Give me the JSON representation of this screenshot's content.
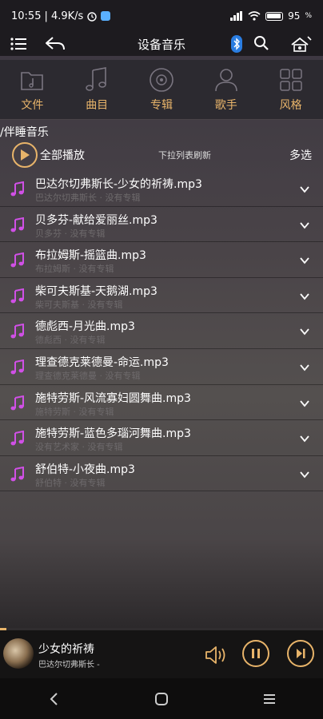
{
  "status_bar": {
    "time": "10:55",
    "speed": "| 4.9K/s",
    "battery": "95"
  },
  "header": {
    "title": "设备音乐"
  },
  "categories": [
    {
      "label": "文件",
      "icon": "folder-music-icon"
    },
    {
      "label": "曲目",
      "icon": "music-note-icon"
    },
    {
      "label": "专辑",
      "icon": "disc-icon"
    },
    {
      "label": "歌手",
      "icon": "person-icon"
    },
    {
      "label": "风格",
      "icon": "grid-icon"
    }
  ],
  "breadcrumb": "/伴睡音乐",
  "actions": {
    "play_all": "全部播放",
    "refresh_hint": "下拉列表刷新",
    "multi_select": "多选"
  },
  "tracks": [
    {
      "title": "巴达尔切弗斯长-少女的祈祷.mp3",
      "subtitle": "巴达尔切弗斯长 · 没有专辑"
    },
    {
      "title": "贝多芬-献给爱丽丝.mp3",
      "subtitle": "贝多芬 · 没有专辑"
    },
    {
      "title": "布拉姆斯-摇篮曲.mp3",
      "subtitle": "布拉姆斯 · 没有专辑"
    },
    {
      "title": "柴可夫斯基-天鹅湖.mp3",
      "subtitle": "柴可夫斯基 · 没有专辑"
    },
    {
      "title": "德彪西-月光曲.mp3",
      "subtitle": "德彪西 · 没有专辑"
    },
    {
      "title": "理查德克莱德曼-命运.mp3",
      "subtitle": "理查德克莱德曼 · 没有专辑"
    },
    {
      "title": "施特劳斯-风流寡妇圆舞曲.mp3",
      "subtitle": "施特劳斯 · 没有专辑"
    },
    {
      "title": "施特劳斯-蓝色多瑙河舞曲.mp3",
      "subtitle": "没有艺术家 · 没有专辑"
    },
    {
      "title": "舒伯特-小夜曲.mp3",
      "subtitle": "舒伯特 · 没有专辑"
    }
  ],
  "player": {
    "title": "少女的祈祷",
    "artist": "巴达尔切弗斯长 -",
    "progress": 0.02
  },
  "colors": {
    "accent": "#e8b46a",
    "note": "#d050e6"
  }
}
